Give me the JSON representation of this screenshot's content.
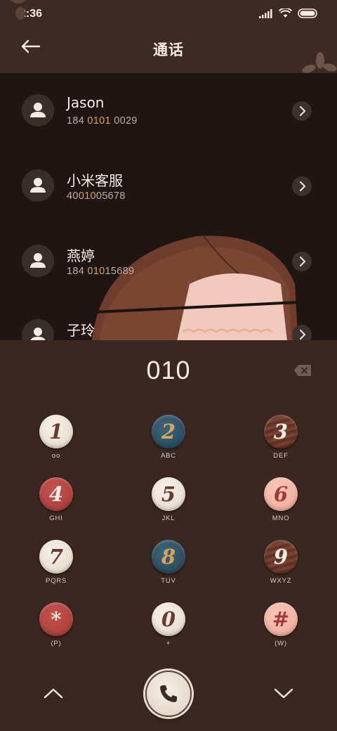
{
  "status_bar": {
    "time": "2:36"
  },
  "header": {
    "title": "通话"
  },
  "contacts": [
    {
      "name": "Jason",
      "number_parts": [
        "184 ",
        "0101",
        " 0029"
      ]
    },
    {
      "name": "小米客服",
      "number_parts": [
        "40",
        "010",
        "05678"
      ]
    },
    {
      "name": "燕婷",
      "number_parts": [
        "184 ",
        "010",
        "15689"
      ]
    },
    {
      "name": "子玲",
      "number_parts": [
        "",
        "",
        ""
      ]
    }
  ],
  "dialer": {
    "input_value": "010",
    "keys": [
      {
        "digit": "1",
        "letters": "oo",
        "style": "cream"
      },
      {
        "digit": "2",
        "letters": "ABC",
        "style": "blue"
      },
      {
        "digit": "3",
        "letters": "DEF",
        "style": "wood"
      },
      {
        "digit": "4",
        "letters": "GHI",
        "style": "red"
      },
      {
        "digit": "5",
        "letters": "JKL",
        "style": "cream"
      },
      {
        "digit": "6",
        "letters": "MNO",
        "style": "pink"
      },
      {
        "digit": "7",
        "letters": "PQRS",
        "style": "cream"
      },
      {
        "digit": "8",
        "letters": "TUV",
        "style": "blue"
      },
      {
        "digit": "9",
        "letters": "WXYZ",
        "style": "wood"
      },
      {
        "digit": "*",
        "letters": "(P)",
        "style": "red"
      },
      {
        "digit": "0",
        "letters": "+",
        "style": "cream"
      },
      {
        "digit": "#",
        "letters": "(W)",
        "style": "pink"
      }
    ]
  },
  "icons": {
    "back": "arrow-left-icon",
    "avatar": "person-icon",
    "row_arrow": "chevron-right-icon",
    "backspace": "backspace-icon",
    "call": "phone-icon",
    "collapse": "chevron-up-icon",
    "expand": "chevron-down-icon"
  },
  "colors": {
    "background": "#3b2721",
    "list_background": "#1f1614",
    "match_highlight": "#d8a15b"
  }
}
